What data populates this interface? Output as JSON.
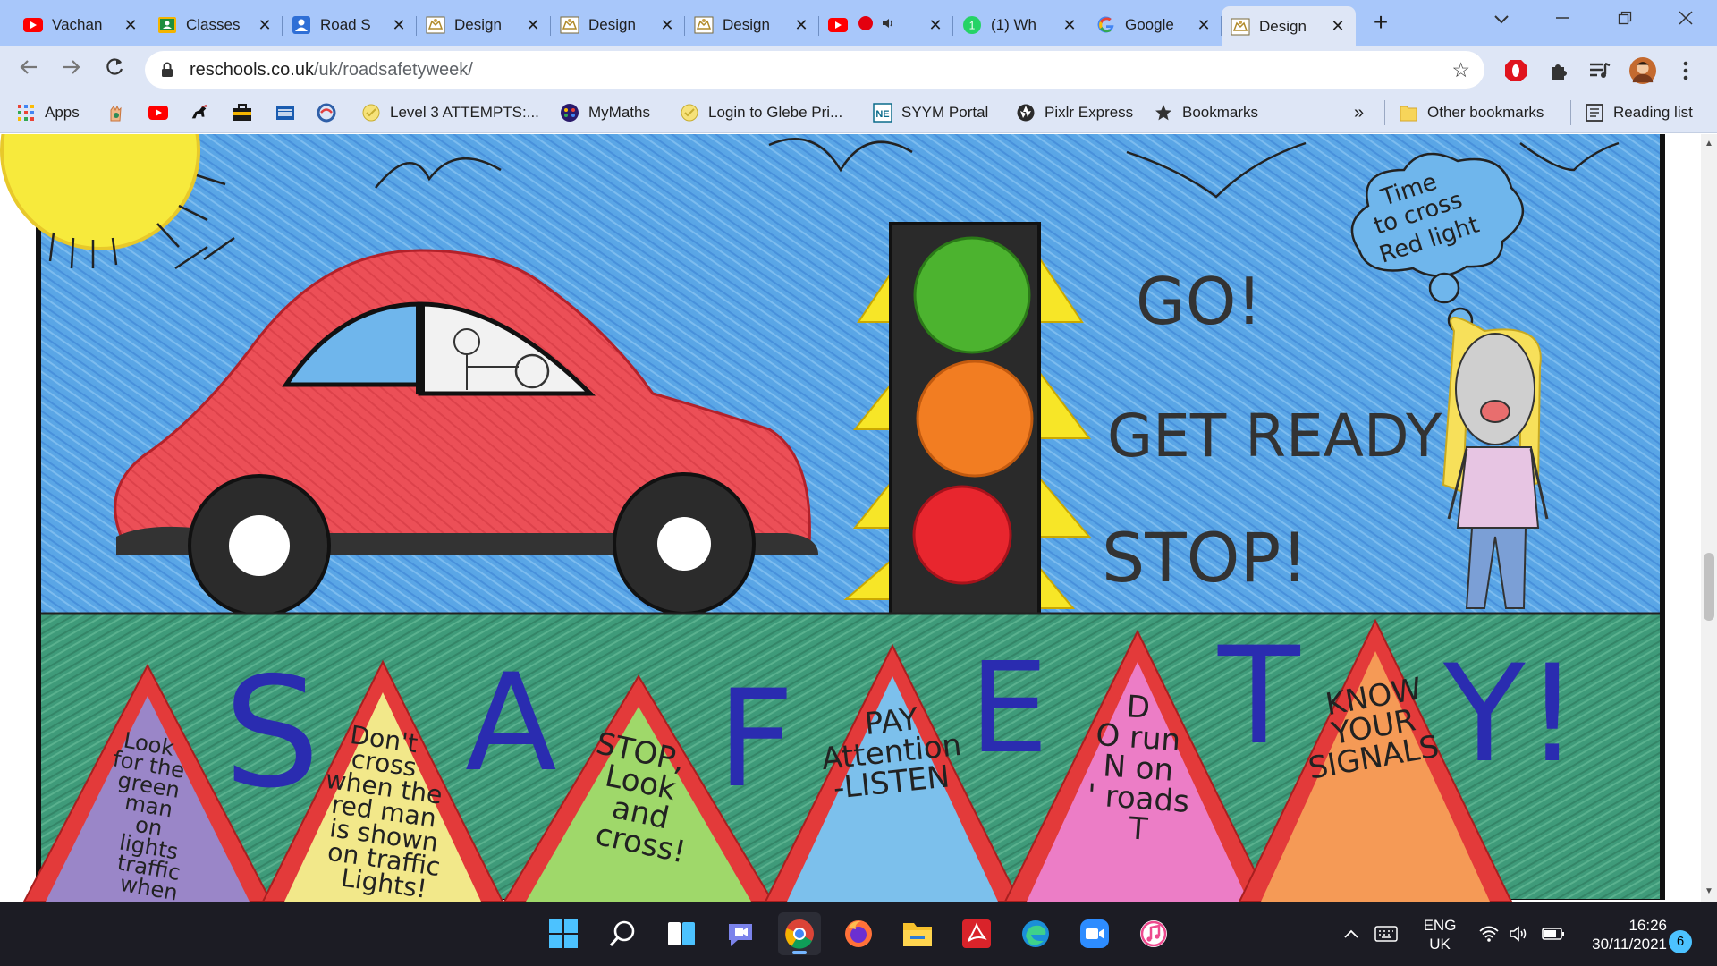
{
  "tabs": [
    {
      "title": "Vachan",
      "icon": "youtube-icon"
    },
    {
      "title": "Classes",
      "icon": "google-classroom-icon"
    },
    {
      "title": "Road S",
      "icon": "person-icon"
    },
    {
      "title": "Design",
      "icon": "crest-icon"
    },
    {
      "title": "Design",
      "icon": "crest-icon"
    },
    {
      "title": "Design",
      "icon": "crest-icon"
    },
    {
      "title": "",
      "icon": "youtube-icon"
    },
    {
      "title": "(1) Wh",
      "icon": "whatsapp-icon"
    },
    {
      "title": "Google",
      "icon": "google-icon"
    },
    {
      "title": "Design",
      "icon": "crest-icon"
    }
  ],
  "address": {
    "domain": "reschools.co.uk",
    "path": "/uk/roadsafetyweek/"
  },
  "bookmarks": [
    {
      "label": "Apps",
      "icon": "apps-grid-icon"
    },
    {
      "label": "",
      "icon": "hand-logo-icon"
    },
    {
      "label": "",
      "icon": "youtube-icon"
    },
    {
      "label": "",
      "icon": "horse-icon"
    },
    {
      "label": "",
      "icon": "briefcase-icon"
    },
    {
      "label": "",
      "icon": "flag-icon"
    },
    {
      "label": "",
      "icon": "swirl-icon"
    },
    {
      "label": "Level 3 ATTEMPTS:...",
      "icon": "badge-icon"
    },
    {
      "label": "MyMaths",
      "icon": "mymaths-icon"
    },
    {
      "label": "Login to Glebe Pri...",
      "icon": "badge-icon"
    },
    {
      "label": "SYYM Portal",
      "icon": "ne-icon"
    },
    {
      "label": "Pixlr Express",
      "icon": "aperture-icon"
    },
    {
      "label": "Bookmarks",
      "icon": "star-icon"
    }
  ],
  "bookmarks_overflow": "»",
  "other_bookmarks": "Other bookmarks",
  "reading_list": "Reading list",
  "drawing": {
    "thought_bubble": [
      "Time",
      "to cross",
      "Red light"
    ],
    "traffic_words": [
      "GO!",
      "GET READY",
      "STOP!"
    ],
    "safety_letters": [
      "S",
      "A",
      "F",
      "E",
      "T",
      "Y!"
    ],
    "triangles": [
      {
        "lines": [
          "Look",
          "for the",
          "green",
          "man",
          "on",
          "lights",
          "traffic",
          "when"
        ],
        "color": "#9a86c8"
      },
      {
        "lines": [
          "Don't",
          "cross",
          "when the",
          "red man",
          "is shown",
          "on traffic",
          "Lights!"
        ],
        "color": "#f2e88a"
      },
      {
        "lines": [
          "STOP,",
          "Look",
          "and",
          "cross!"
        ],
        "color": "#9fd86a"
      },
      {
        "lines": [
          "PAY",
          "Attention",
          "-LISTEN"
        ],
        "color": "#7cc0ec"
      },
      {
        "lines": [
          "D",
          "O run",
          "N on",
          "' roads",
          "T"
        ],
        "color": "#ec7dc6"
      },
      {
        "lines": [
          "KNOW",
          "YOUR",
          "SIGNALS"
        ],
        "color": "#f59a56"
      }
    ]
  },
  "taskbar": {
    "apps": [
      "windows-start-icon",
      "search-icon",
      "widgets-icon",
      "teams-chat-icon",
      "chrome-icon",
      "firefox-icon",
      "file-explorer-icon",
      "acrobat-icon",
      "edge-icon",
      "zoom-icon",
      "itunes-icon"
    ],
    "lang_line1": "ENG",
    "lang_line2": "UK",
    "time": "16:26",
    "date": "30/11/2021",
    "notifications": "6"
  }
}
